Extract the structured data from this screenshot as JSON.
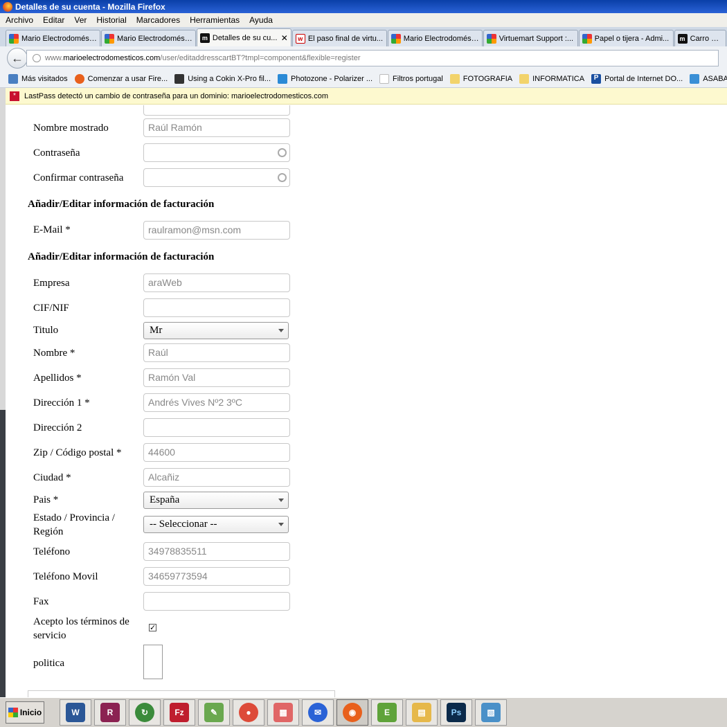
{
  "window": {
    "title": "Detalles de su cuenta - Mozilla Firefox"
  },
  "menu": [
    "Archivo",
    "Editar",
    "Ver",
    "Historial",
    "Marcadores",
    "Herramientas",
    "Ayuda"
  ],
  "tabs": [
    {
      "label": "Mario Electrodomésti...",
      "icon": "joomla-icon",
      "active": false
    },
    {
      "label": "Mario Electrodomésti...",
      "icon": "joomla-icon",
      "active": false
    },
    {
      "label": "Detalles de su cu...",
      "icon": "m-icon",
      "active": true
    },
    {
      "label": "El paso final de virtu...",
      "icon": "w-icon",
      "active": false
    },
    {
      "label": "Mario Electrodomésti...",
      "icon": "joomla-icon",
      "active": false
    },
    {
      "label": "Virtuemart Support :...",
      "icon": "joomla-icon",
      "active": false
    },
    {
      "label": "Papel o tijera - Admi...",
      "icon": "joomla-icon",
      "active": false
    },
    {
      "label": "Carro de co",
      "icon": "m-icon",
      "active": false
    }
  ],
  "tab_close": "✕",
  "url": {
    "prefix": "www.",
    "domain": "marioelectrodomesticos.com",
    "path": "/user/editaddresscartBT?tmpl=component&flexible=register"
  },
  "bookmarks": [
    {
      "label": "Más visitados",
      "icon": "user-icon",
      "color": "#4a7fc1"
    },
    {
      "label": "Comenzar a usar Fire...",
      "icon": "firefox-icon",
      "color": "#e8601c"
    },
    {
      "label": "Using a Cokin X-Pro fil...",
      "icon": "camera-icon",
      "color": "#333333"
    },
    {
      "label": "Photozone - Polarizer ...",
      "icon": "photozone-icon",
      "color": "#2a8ad6"
    },
    {
      "label": "Filtros portugal",
      "icon": "page-icon",
      "color": "#ffffff"
    },
    {
      "label": "FOTOGRAFIA",
      "icon": "folder-icon",
      "color": "#f2d36b"
    },
    {
      "label": "INFORMATICA",
      "icon": "folder-icon",
      "color": "#f2d36b"
    },
    {
      "label": "Portal de Internet DO...",
      "icon": "p-icon",
      "color": "#1a4fa0"
    },
    {
      "label": "ASABAF - N",
      "icon": "asabaf-icon",
      "color": "#3a8fd6"
    }
  ],
  "lastpass": {
    "message": "LastPass detectó un cambio de contraseña para un dominio: marioelectrodomesticos.com",
    "icon": "*"
  },
  "form": {
    "display_name": {
      "label": "Nombre mostrado",
      "value": "Raúl Ramón"
    },
    "password": {
      "label": "Contraseña",
      "value": ""
    },
    "confirm_password": {
      "label": "Confirmar contraseña",
      "value": ""
    },
    "section1": "Añadir/Editar información de facturación",
    "email": {
      "label": "E-Mail *",
      "value": "raulramon@msn.com"
    },
    "section2": "Añadir/Editar información de facturación",
    "company": {
      "label": "Empresa",
      "value": "araWeb"
    },
    "cif": {
      "label": "CIF/NIF",
      "value": ""
    },
    "title": {
      "label": "Titulo",
      "value": "Mr"
    },
    "first_name": {
      "label": "Nombre *",
      "value": "Raúl"
    },
    "last_name": {
      "label": "Apellidos *",
      "value": "Ramón Val"
    },
    "address1": {
      "label": "Dirección 1 *",
      "value": "Andrés Vives Nº2 3ºC"
    },
    "address2": {
      "label": "Dirección 2",
      "value": ""
    },
    "zip": {
      "label": "Zip / Código postal *",
      "value": "44600"
    },
    "city": {
      "label": "Ciudad *",
      "value": "Alcañiz"
    },
    "country": {
      "label": "Pais *",
      "value": "España"
    },
    "state": {
      "label": "Estado / Provincia / Región",
      "value": "-- Seleccionar --"
    },
    "phone": {
      "label": "Teléfono",
      "value": "34978835511"
    },
    "mobile": {
      "label": "Teléfono Movil",
      "value": "34659773594"
    },
    "fax": {
      "label": "Fax",
      "value": ""
    },
    "tos": {
      "label": "Acepto los términos de servicio",
      "checked": true,
      "mark": "✓"
    },
    "policy": {
      "label": "politica"
    }
  },
  "taskbar": {
    "start_label": "Inicio",
    "apps": [
      {
        "name": "word-icon",
        "glyph": "W",
        "color": "#2b5797"
      },
      {
        "name": "winrar-icon",
        "glyph": "R",
        "color": "#8b2252"
      },
      {
        "name": "sync-icon",
        "glyph": "↻",
        "color": "#3b8b3b"
      },
      {
        "name": "filezilla-icon",
        "glyph": "Fz",
        "color": "#bf1e2e"
      },
      {
        "name": "paint-icon",
        "glyph": "✎",
        "color": "#6aa84f"
      },
      {
        "name": "chrome-icon",
        "glyph": "●",
        "color": "#dd4b39"
      },
      {
        "name": "apps-grid-icon",
        "glyph": "▦",
        "color": "#e06666"
      },
      {
        "name": "thunderbird-icon",
        "glyph": "✉",
        "color": "#2a62d6"
      },
      {
        "name": "firefox-icon",
        "glyph": "◉",
        "color": "#e8601c",
        "active": true
      },
      {
        "name": "evernote-icon",
        "glyph": "E",
        "color": "#5fa33a"
      },
      {
        "name": "explorer-icon",
        "glyph": "▤",
        "color": "#e6b84a"
      },
      {
        "name": "photoshop-icon",
        "glyph": "Ps",
        "color": "#0b2a4a"
      },
      {
        "name": "picture-icon",
        "glyph": "▧",
        "color": "#4a90c8"
      }
    ]
  }
}
